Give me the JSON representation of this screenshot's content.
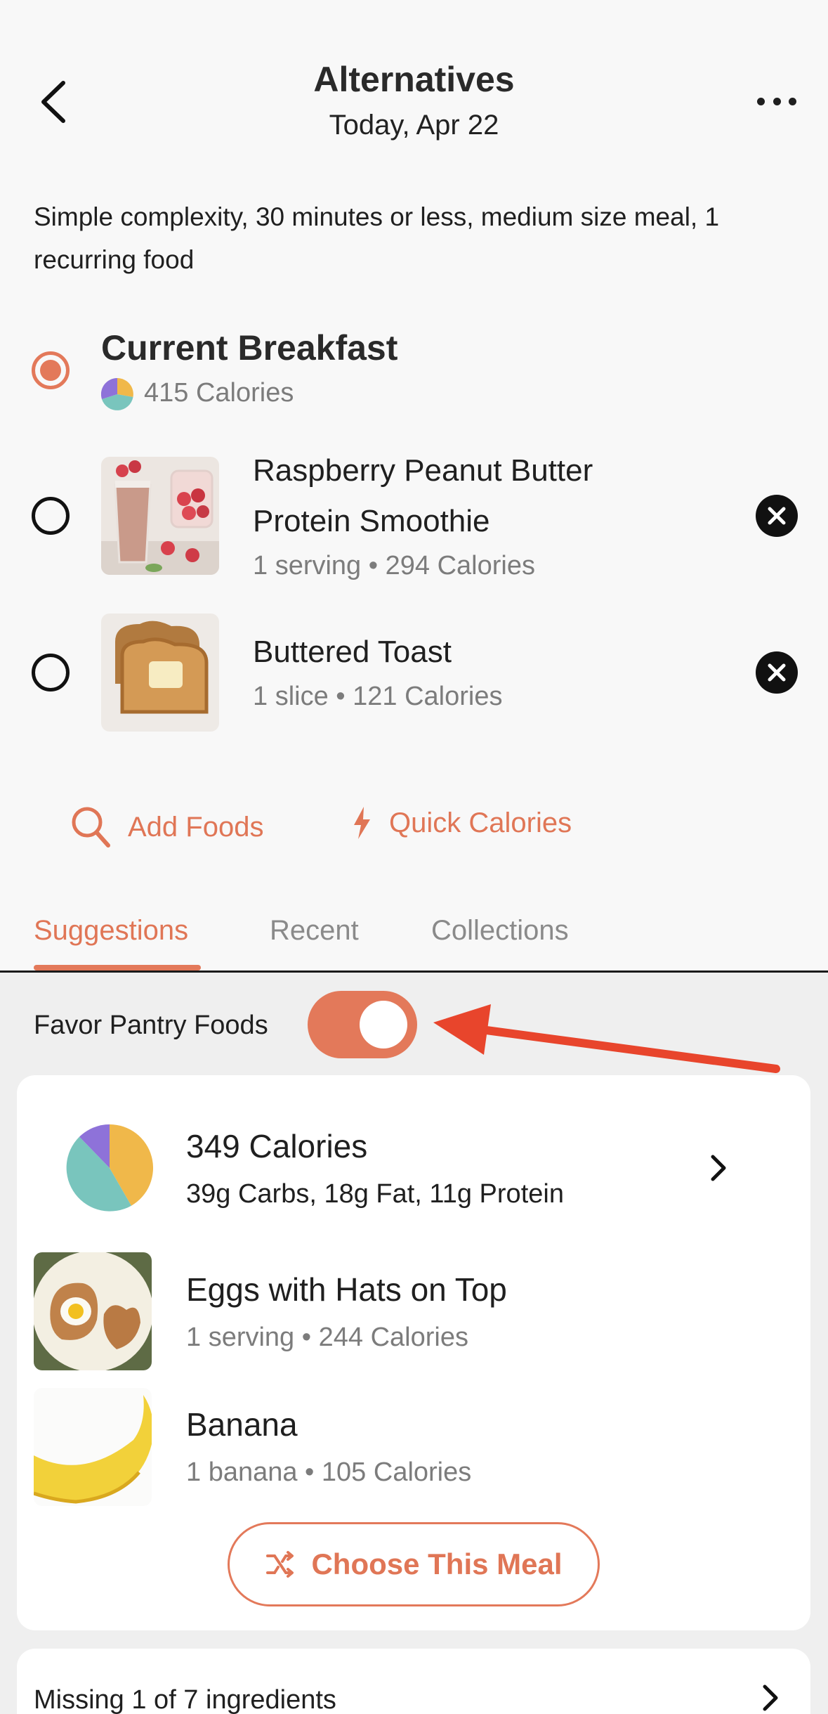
{
  "header": {
    "title": "Alternatives",
    "subtitle": "Today, Apr 22"
  },
  "description": "Simple complexity, 30 minutes or less, medium size meal, 1 recurring food",
  "current_meal": {
    "title": "Current Breakfast",
    "calories": "415 Calories"
  },
  "foods": [
    {
      "name_line1": "Raspberry Peanut Butter",
      "name_line2": "Protein Smoothie",
      "meta": "1 serving • 294 Calories",
      "image": "smoothie-photo"
    },
    {
      "name_line1": "Buttered Toast",
      "meta": "1 slice • 121 Calories",
      "image": "toast-photo"
    }
  ],
  "actions": {
    "add_foods": "Add Foods",
    "quick_calories": "Quick Calories"
  },
  "tabs": [
    {
      "label": "Suggestions",
      "active": true
    },
    {
      "label": "Recent",
      "active": false
    },
    {
      "label": "Collections",
      "active": false
    }
  ],
  "pantry": {
    "label": "Favor Pantry Foods",
    "enabled": true
  },
  "suggestion": {
    "calories": "349 Calories",
    "macros": "39g Carbs, 18g Fat, 11g Protein",
    "items": [
      {
        "name": "Eggs with Hats on Top",
        "meta": "1 serving • 244 Calories",
        "image": "eggs-toast-photo"
      },
      {
        "name": "Banana",
        "meta": "1 banana • 105 Calories",
        "image": "banana-photo"
      }
    ],
    "choose_label": "Choose This Meal"
  },
  "missing": {
    "text": "Missing 1 of 7 ingredients"
  },
  "colors": {
    "accent": "#e3795a",
    "carbs": "#f0b84a",
    "fat": "#79c5bd",
    "protein": "#8e72d9",
    "annotation_arrow": "#e8452c"
  },
  "icons": [
    "back-chevron-icon",
    "more-icon",
    "search-icon",
    "lightning-icon",
    "close-circle-icon",
    "chevron-right-icon",
    "shuffle-icon"
  ]
}
